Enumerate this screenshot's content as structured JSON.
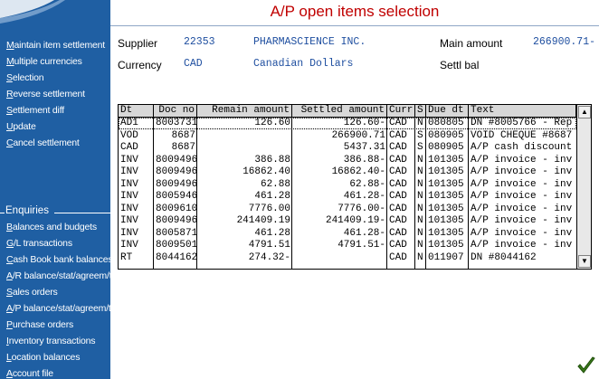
{
  "sidebar": {
    "items": [
      {
        "label": "Maintain item settlement",
        "ul": "M"
      },
      {
        "label": "Multiple currencies",
        "ul": "M"
      },
      {
        "label": "Selection",
        "ul": "S"
      },
      {
        "label": "Reverse settlement",
        "ul": "R"
      },
      {
        "label": "Settlement diff",
        "ul": "S"
      },
      {
        "label": "Update",
        "ul": "U"
      },
      {
        "label": "Cancel settlement",
        "ul": "C"
      }
    ],
    "enquiries_title": "Enquiries",
    "enquiries": [
      {
        "label": "Balances and budgets",
        "ul": "B"
      },
      {
        "label": "G/L transactions",
        "ul": "G"
      },
      {
        "label": "Cash Book bank balances",
        "ul": "C"
      },
      {
        "label": "A/R balance/stat/agreem/trar",
        "ul": "A"
      },
      {
        "label": "Sales orders",
        "ul": "S"
      },
      {
        "label": "A/P balance/stat/agreem/trar",
        "ul": "A"
      },
      {
        "label": "Purchase orders",
        "ul": "P"
      },
      {
        "label": "Inventory transactions",
        "ul": "I"
      },
      {
        "label": "Location balances",
        "ul": "L"
      },
      {
        "label": "Account file",
        "ul": "A"
      }
    ]
  },
  "title": "A/P open items selection",
  "header": {
    "supplier_label": "Supplier",
    "supplier_code": "22353",
    "supplier_name": "PHARMASCIENCE INC.",
    "main_amount_label": "Main amount",
    "main_amount": "266900.71-",
    "currency_label": "Currency",
    "currency_code": "CAD",
    "currency_name": "Canadian Dollars",
    "settl_bal_label": "Settl bal"
  },
  "grid": {
    "columns": [
      "Dt",
      "Doc no",
      "Remain amount",
      "Settled amount",
      "Curr",
      "S",
      "Due dt",
      "Text"
    ],
    "rows": [
      [
        "AD1",
        "8003731",
        "126.60",
        "126.60-",
        "CAD",
        "N",
        "080805",
        "DN #8005766 - Rep"
      ],
      [
        "VOD",
        "8687",
        "",
        "266900.71",
        "CAD",
        "S",
        "080905",
        "VOID CHEQUE #8687"
      ],
      [
        "CAD",
        "8687",
        "",
        "5437.31",
        "CAD",
        "S",
        "080905",
        "A/P cash discount"
      ],
      [
        "INV",
        "8009496",
        "386.88",
        "386.88-",
        "CAD",
        "N",
        "101305",
        "A/P invoice - inv"
      ],
      [
        "INV",
        "8009496",
        "16862.40",
        "16862.40-",
        "CAD",
        "N",
        "101305",
        "A/P invoice - inv"
      ],
      [
        "INV",
        "8009496",
        "62.88",
        "62.88-",
        "CAD",
        "N",
        "101305",
        "A/P invoice - inv"
      ],
      [
        "INV",
        "8005946",
        "461.28",
        "461.28-",
        "CAD",
        "N",
        "101305",
        "A/P invoice - inv"
      ],
      [
        "INV",
        "8009610",
        "7776.00",
        "7776.00-",
        "CAD",
        "N",
        "101305",
        "A/P invoice - inv"
      ],
      [
        "INV",
        "8009496",
        "241409.19",
        "241409.19-",
        "CAD",
        "N",
        "101305",
        "A/P invoice - inv"
      ],
      [
        "INV",
        "8005871",
        "461.28",
        "461.28-",
        "CAD",
        "N",
        "101305",
        "A/P invoice - inv"
      ],
      [
        "INV",
        "8009501",
        "4791.51",
        "4791.51-",
        "CAD",
        "N",
        "101305",
        "A/P invoice - inv"
      ],
      [
        "RT",
        "8044162",
        "274.32-",
        "",
        "CAD",
        "N",
        "011907",
        "DN #8044162"
      ]
    ]
  },
  "icons": {
    "scroll_up": "scroll-up-icon",
    "scroll_down": "scroll-down-icon",
    "ok": "checkmark-icon"
  },
  "colors": {
    "sidebar": "#1f5fa3",
    "title": "#c00000",
    "value": "#1f4fa0",
    "ok_icon": "#3a7a1a"
  }
}
